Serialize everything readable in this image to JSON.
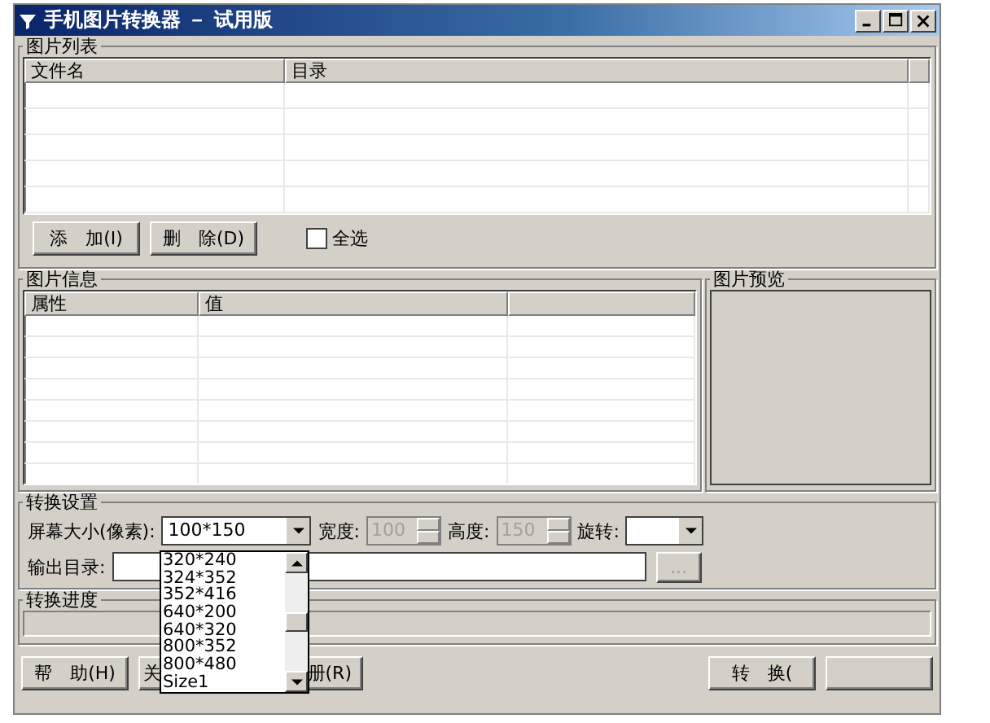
{
  "window": {
    "title": "手机图片转换器 － 试用版"
  },
  "file_list": {
    "title": "图片列表",
    "columns": [
      "文件名",
      "目录"
    ]
  },
  "list_buttons": [
    {
      "label": "添　加(I)"
    },
    {
      "label": "删　除(D)"
    }
  ],
  "select_all": {
    "label": "全选",
    "checked": false
  },
  "info": {
    "title": "图片信息",
    "columns": [
      "属性",
      "值"
    ]
  },
  "preview": {
    "title": "图片预览"
  },
  "settings": {
    "title": "转换设置",
    "screen_size": {
      "label": "屏幕大小(像素):",
      "value": "100*150"
    },
    "width": {
      "label": "宽度:",
      "value": "100",
      "disabled": true
    },
    "height": {
      "label": "高度:",
      "value": "150",
      "disabled": true
    },
    "rotate": {
      "label": "旋转:"
    },
    "output": {
      "label": "输出目录:"
    },
    "browse": {
      "label": "...",
      "disabled": true
    }
  },
  "progress": {
    "title": "转换进度",
    "level": 0
  },
  "dropdown": {
    "items": [
      {
        "label": "320*240",
        "selected": false
      },
      {
        "label": "324*352",
        "selected": false
      },
      {
        "label": "352*416",
        "selected": false
      },
      {
        "label": "640*200",
        "selected": false
      },
      {
        "label": "640*320",
        "selected": false
      },
      {
        "label": "800*352",
        "selected": false
      },
      {
        "label": "800*480",
        "selected": false
      },
      {
        "label": "Size1",
        "selected": false
      }
    ]
  },
  "bottom_buttons": [
    {
      "label": "帮　助(H)"
    },
    {
      "label": "关"
    },
    {
      "label": "册(R)"
    }
  ],
  "right_buttons": [
    {
      "kind": "text",
      "label": "转　换("
    },
    {
      "kind": "blank"
    }
  ]
}
